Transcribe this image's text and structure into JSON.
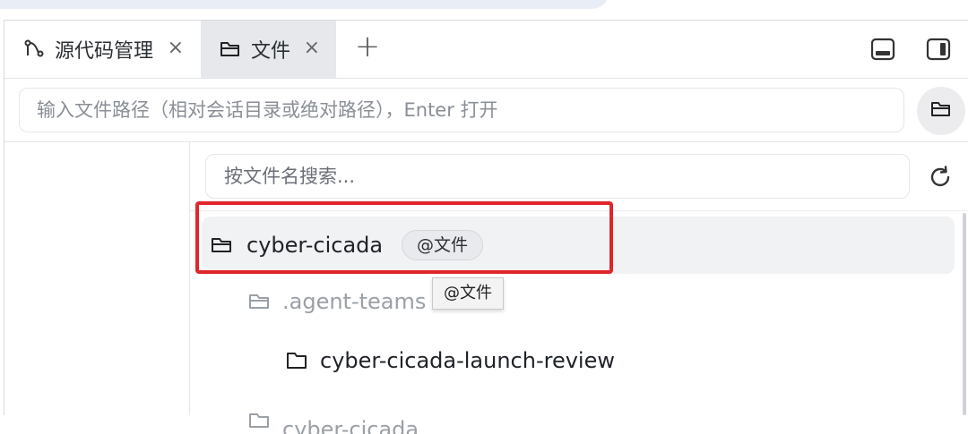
{
  "tabs": [
    {
      "label": "源代码管理",
      "icon": "source-control-icon",
      "close": "×"
    },
    {
      "label": "文件",
      "icon": "folder-icon",
      "close": "×"
    }
  ],
  "tab_add": "+",
  "path_input": {
    "placeholder": "输入文件路径（相对会话目录或绝对路径），Enter 打开"
  },
  "search_input": {
    "placeholder": "按文件名搜索..."
  },
  "tree": {
    "root": {
      "name": "cyber-cicada",
      "chip": "@文件"
    },
    "children": [
      {
        "name": ".agent-teams"
      },
      {
        "name": "cyber-cicada-launch-review"
      }
    ],
    "partial_row": "cyber-cicada"
  },
  "tooltip": "@文件",
  "colors": {
    "highlight": "#e0252b",
    "selected_row": "#f1f2f4",
    "active_tab": "#e6e8eb"
  }
}
